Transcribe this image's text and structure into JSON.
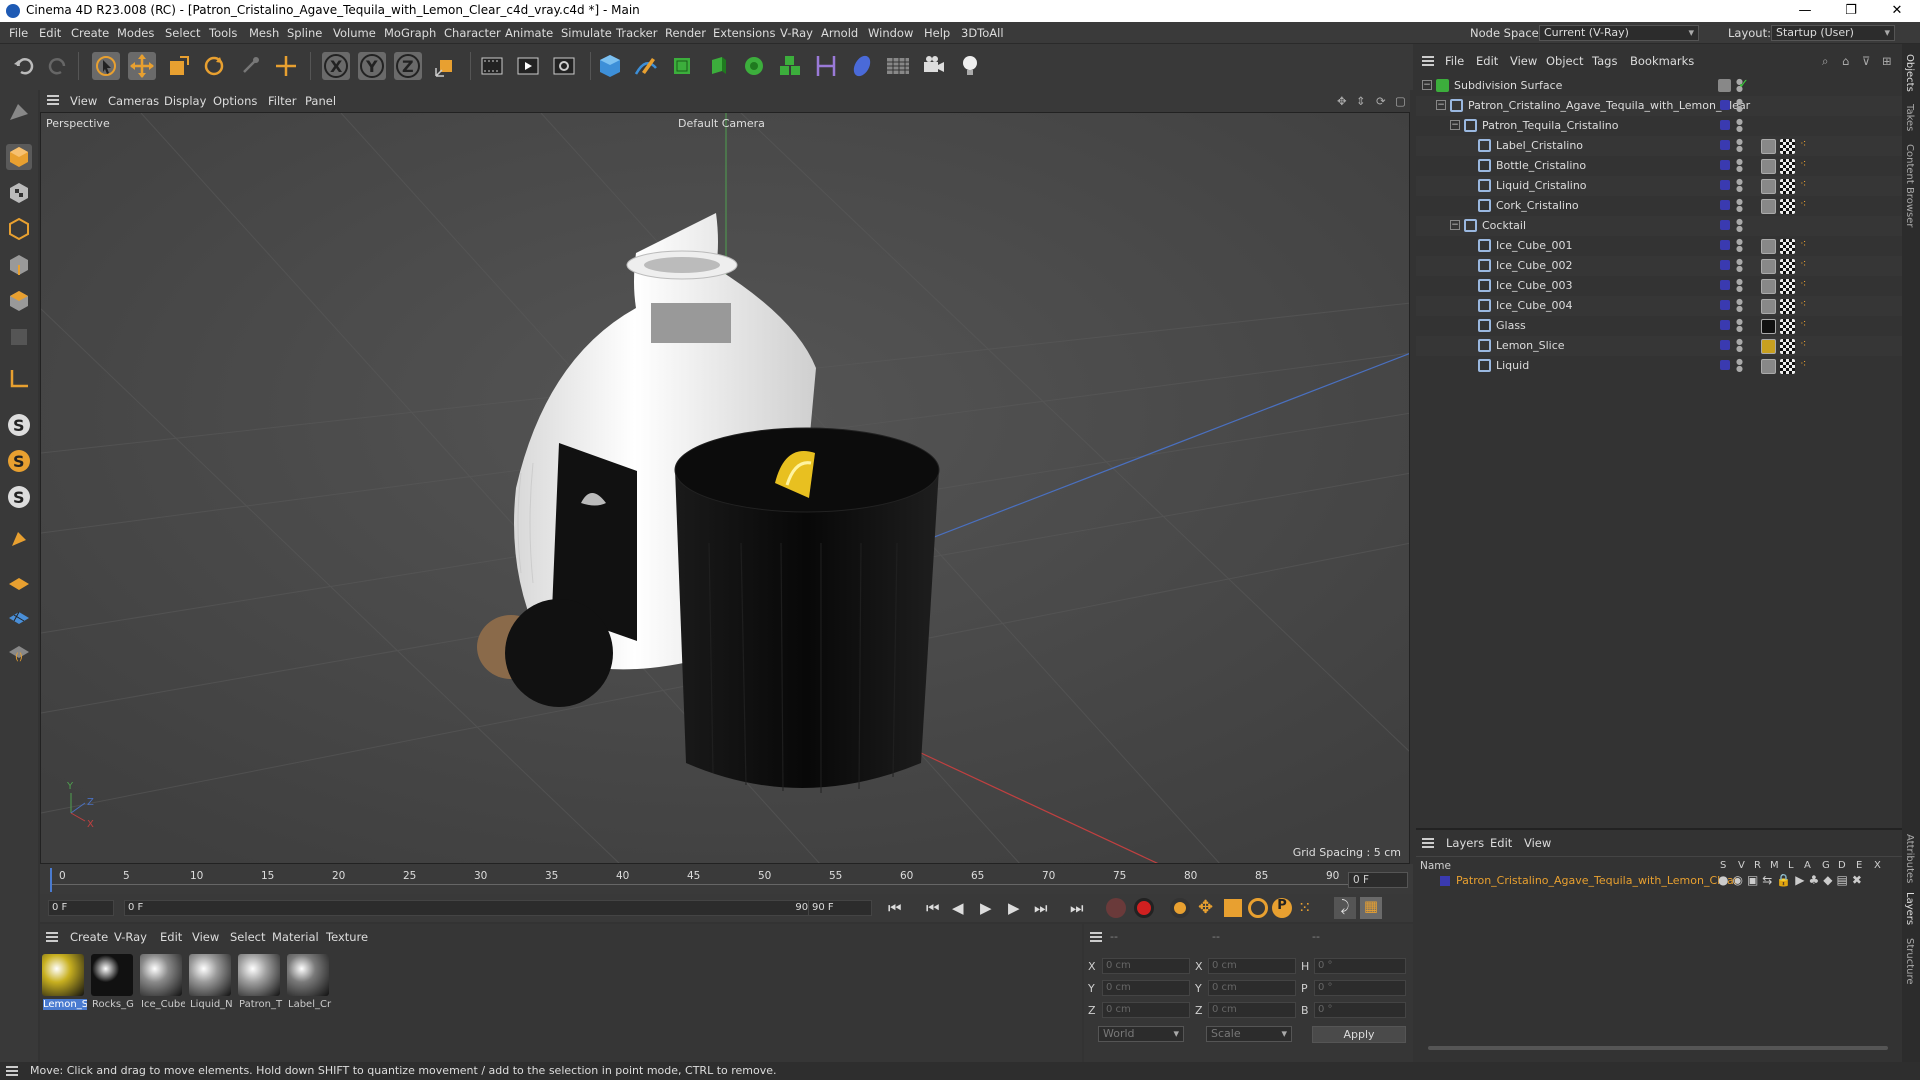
{
  "window": {
    "title": "Cinema 4D R23.008 (RC) - [Patron_Cristalino_Agave_Tequila_with_Lemon_Clear_c4d_vray.c4d *] - Main",
    "minimize": "—",
    "maximize": "❐",
    "close": "✕"
  },
  "menu": [
    "File",
    "Edit",
    "Create",
    "Modes",
    "Select",
    "Tools",
    "Mesh",
    "Spline",
    "Volume",
    "MoGraph",
    "Character",
    "Animate",
    "Simulate",
    "Tracker",
    "Render",
    "Extensions",
    "V-Ray",
    "Arnold",
    "Window",
    "Help",
    "3DToAll"
  ],
  "nodespace": {
    "label": "Node Space:",
    "value": "Current (V-Ray)"
  },
  "layout": {
    "label": "Layout:",
    "value": "Startup (User)"
  },
  "viewport": {
    "menu": [
      "View",
      "Cameras",
      "Display",
      "Options",
      "Filter",
      "Panel"
    ],
    "label": "Perspective",
    "camera": "Default Camera",
    "grid_spacing": "Grid Spacing : 5 cm"
  },
  "timeline": {
    "ticks": [
      "0",
      "5",
      "10",
      "15",
      "20",
      "25",
      "30",
      "35",
      "40",
      "45",
      "50",
      "55",
      "60",
      "65",
      "70",
      "75",
      "80",
      "85",
      "90"
    ],
    "current": "0 F",
    "start": "0 F",
    "range_start": "0 F",
    "range_end": "90 F",
    "end": "90 F"
  },
  "materials": {
    "menu": [
      "Create",
      "V-Ray",
      "Edit",
      "View",
      "Select",
      "Material",
      "Texture"
    ],
    "items": [
      {
        "label": "Lemon_S",
        "color": "#c8b020"
      },
      {
        "label": "Rocks_G",
        "color": "#111111"
      },
      {
        "label": "Ice_Cube",
        "color": "#8a8a8a"
      },
      {
        "label": "Liquid_N",
        "color": "#9a9a9a"
      },
      {
        "label": "Patron_T",
        "color": "#a0a0a0"
      },
      {
        "label": "Label_Cr",
        "color": "#7a7a7a"
      }
    ]
  },
  "coords": {
    "headers": [
      "--",
      "--",
      "--"
    ],
    "rows": [
      {
        "a": "X",
        "av": "0 cm",
        "b": "X",
        "bv": "0 cm",
        "c": "H",
        "cv": "0 °"
      },
      {
        "a": "Y",
        "av": "0 cm",
        "b": "Y",
        "bv": "0 cm",
        "c": "P",
        "cv": "0 °"
      },
      {
        "a": "Z",
        "av": "0 cm",
        "b": "Z",
        "bv": "0 cm",
        "c": "B",
        "cv": "0 °"
      }
    ],
    "world": "World",
    "scale": "Scale",
    "apply": "Apply"
  },
  "objects": {
    "menu": [
      "File",
      "Edit",
      "View",
      "Object",
      "Tags",
      "Bookmarks"
    ],
    "items": [
      {
        "name": "Subdivision Surface",
        "indent": 0
      },
      {
        "name": "Patron_Cristalino_Agave_Tequila_with_Lemon_Clear",
        "indent": 1
      },
      {
        "name": "Patron_Tequila_Cristalino",
        "indent": 2
      },
      {
        "name": "Label_Cristalino",
        "indent": 3
      },
      {
        "name": "Bottle_Cristalino",
        "indent": 3
      },
      {
        "name": "Liquid_Cristalino",
        "indent": 3
      },
      {
        "name": "Cork_Cristalino",
        "indent": 3
      },
      {
        "name": "Cocktail",
        "indent": 2
      },
      {
        "name": "Ice_Cube_001",
        "indent": 3
      },
      {
        "name": "Ice_Cube_002",
        "indent": 3
      },
      {
        "name": "Ice_Cube_003",
        "indent": 3
      },
      {
        "name": "Ice_Cube_004",
        "indent": 3
      },
      {
        "name": "Glass",
        "indent": 3
      },
      {
        "name": "Lemon_Slice",
        "indent": 3
      },
      {
        "name": "Liquid",
        "indent": 3
      }
    ]
  },
  "layers": {
    "menu": [
      "Layers",
      "Edit",
      "View"
    ],
    "col_name": "Name",
    "cols": [
      "S",
      "V",
      "R",
      "M",
      "L",
      "A",
      "G",
      "D",
      "E",
      "X"
    ],
    "item": "Patron_Cristalino_Agave_Tequila_with_Lemon_Clear"
  },
  "side_tabs": [
    "Objects",
    "Takes",
    "Content Browser",
    "Attributes",
    "Layers",
    "Structure"
  ],
  "status": "Move: Click and drag to move elements. Hold down SHIFT to quantize movement / add to the selection in point mode, CTRL to remove.",
  "colors": {
    "accent": "#e08a1e",
    "select": "#4a7bd0"
  }
}
